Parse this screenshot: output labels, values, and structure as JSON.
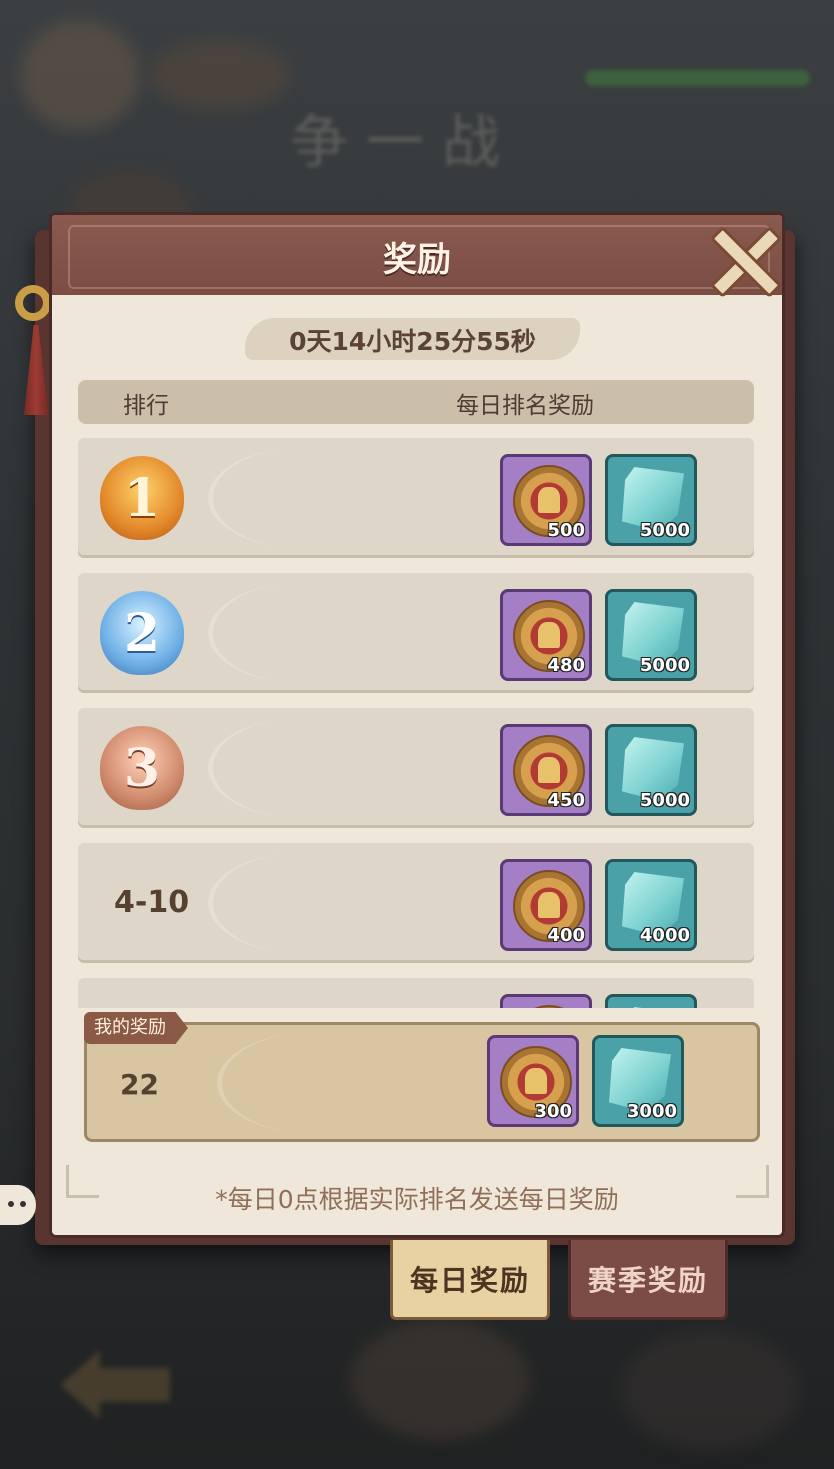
{
  "background": {
    "title_text": "争一战"
  },
  "dialog": {
    "title": "奖励",
    "countdown": "0天14小时25分55秒",
    "columns": {
      "rank": "排行",
      "reward": "每日排名奖励"
    },
    "rows": [
      {
        "rank": "1",
        "medal": "gold-medal-icon",
        "coin": "500",
        "gem": "5000"
      },
      {
        "rank": "2",
        "medal": "silver-medal-icon",
        "coin": "480",
        "gem": "5000"
      },
      {
        "rank": "3",
        "medal": "bronze-medal-icon",
        "coin": "450",
        "gem": "5000"
      },
      {
        "rank": "4-10",
        "medal": null,
        "coin": "400",
        "gem": "4000"
      }
    ],
    "my_reward": {
      "tag": "我的奖励",
      "rank": "22",
      "coin": "300",
      "gem": "3000"
    },
    "footnote": "*每日0点根据实际排名发送每日奖励"
  },
  "tabs": {
    "daily": "每日奖励",
    "season": "赛季奖励",
    "active": "daily"
  },
  "colors": {
    "header": "#7b4d44",
    "panel": "#efe8da",
    "coin_bg": "#a57fc6",
    "gem_bg": "#4aa1a8"
  }
}
